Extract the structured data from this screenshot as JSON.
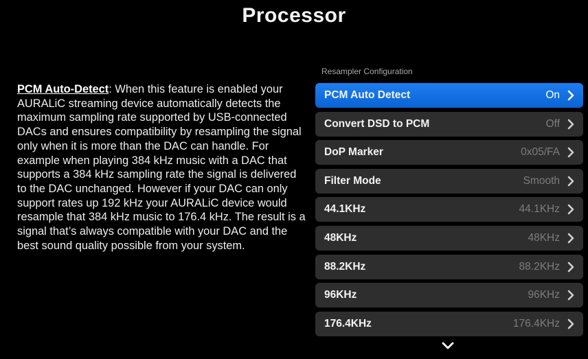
{
  "header": {
    "title": "Processor"
  },
  "description": {
    "term": "PCM Auto-Detect",
    "text": ": When this feature is enabled your AURALiC streaming device automatically detects the maximum sampling rate supported by USB-connected DACs and ensures compatibility by resampling the signal only when it is more than the DAC can handle. For example when playing 384 kHz music with a DAC that supports a 384 kHz sampling rate the signal is delivered to the DAC unchanged. However if your DAC can only support rates up 192 kHz your AURALiC device would resample that 384 kHz music to 176.4 kHz. The result is a signal that’s always compatible with your DAC and the best sound quality possible from your system."
  },
  "settings": {
    "section_label": "Resampler Configuration",
    "rows": [
      {
        "label": "PCM Auto Detect",
        "value": "On",
        "selected": true
      },
      {
        "label": "Convert DSD to PCM",
        "value": "Off",
        "selected": false
      },
      {
        "label": "DoP Marker",
        "value": "0x05/FA",
        "selected": false
      },
      {
        "label": "Filter Mode",
        "value": "Smooth",
        "selected": false
      },
      {
        "label": "44.1KHz",
        "value": "44.1KHz",
        "selected": false
      },
      {
        "label": "48KHz",
        "value": "48KHz",
        "selected": false
      },
      {
        "label": "88.2KHz",
        "value": "88.2KHz",
        "selected": false
      },
      {
        "label": "96KHz",
        "value": "96KHz",
        "selected": false
      },
      {
        "label": "176.4KHz",
        "value": "176.4KHz",
        "selected": false
      }
    ]
  },
  "icons": {
    "row_arrow": "chevron-right-icon",
    "scroll_more": "chevron-down-icon"
  },
  "colors": {
    "selected_row": "#1676e8",
    "row_bg": "#2e2e2e",
    "background": "#000000"
  }
}
